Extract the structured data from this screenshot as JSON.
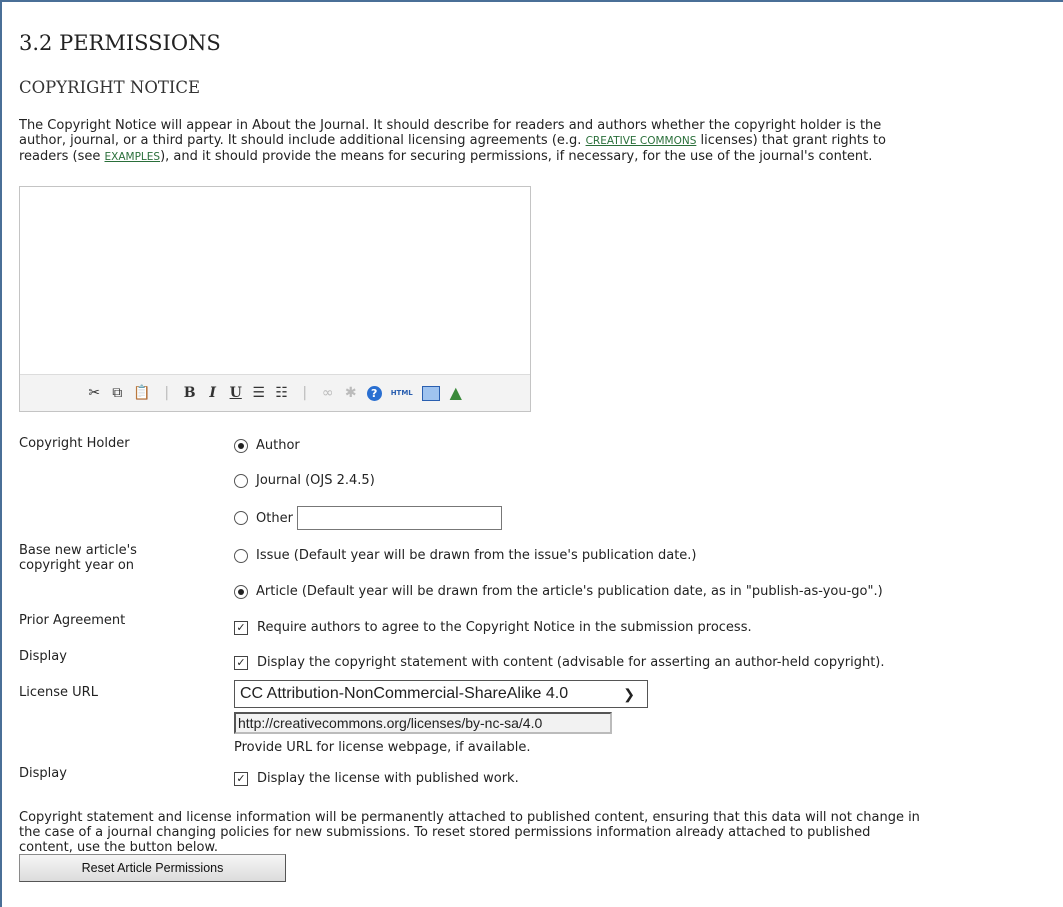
{
  "section": {
    "title": "3.2 PERMISSIONS",
    "subtitle": "COPYRIGHT NOTICE"
  },
  "description": {
    "line1": "The Copyright Notice will appear in About the Journal. It should describe for readers and authors whether the copyright holder is the",
    "line2_a": "author, journal, or a third party. It should include additional licensing agreements (e.g. ",
    "line2_link": "CREATIVE COMMONS",
    "line2_b": " licenses) that grant rights to",
    "line3_a": "readers (see ",
    "line3_link": "EXAMPLES",
    "line3_b": "), and it should provide the means for securing permissions, if necessary, for the use of the journal's content."
  },
  "editor": {
    "toolbar": [
      "cut-icon",
      "copy-icon",
      "paste-icon",
      "bold-icon",
      "italic-icon",
      "underline-icon",
      "bullet-list-icon",
      "numbered-list-icon",
      "link-icon",
      "unlink-icon",
      "help-icon",
      "html-icon",
      "fullscreen-icon",
      "insert-image-icon"
    ],
    "labels": {
      "bold": "B",
      "italic": "I",
      "underline": "U",
      "html": "HTML",
      "help": "?"
    }
  },
  "copyright_holder": {
    "label": "Copyright Holder",
    "options": [
      "Author",
      "Journal (OJS 2.4.5)",
      "Other"
    ],
    "selected": "Author",
    "other_value": ""
  },
  "copyright_year": {
    "label_line1": "Base new article's",
    "label_line2": "copyright year on",
    "options": [
      "Issue (Default year will be drawn from the issue's publication date.)",
      "Article (Default year will be drawn from the article's publication date, as in \"publish-as-you-go\".)"
    ],
    "selected": "Article"
  },
  "prior_agreement": {
    "label": "Prior Agreement",
    "text": "Require authors to agree to the Copyright Notice in the submission process.",
    "checked": true
  },
  "display_copyright": {
    "label": "Display",
    "text": "Display the copyright statement with content (advisable for asserting an author-held copyright).",
    "checked": true
  },
  "license": {
    "label": "License URL",
    "selected": "CC Attribution-NonCommercial-ShareAlike 4.0",
    "url": "http://creativecommons.org/licenses/by-nc-sa/4.0",
    "hint": "Provide URL for license webpage, if available."
  },
  "display_license": {
    "label": "Display",
    "text": "Display the license with published work.",
    "checked": true
  },
  "footer": {
    "line1": "Copyright statement and license information will be permanently attached to published content, ensuring that this data will not change in",
    "line2": "the case of a journal changing policies for new submissions. To reset stored permissions information already attached to published",
    "line3": "content, use the button below.",
    "button": "Reset Article Permissions"
  }
}
